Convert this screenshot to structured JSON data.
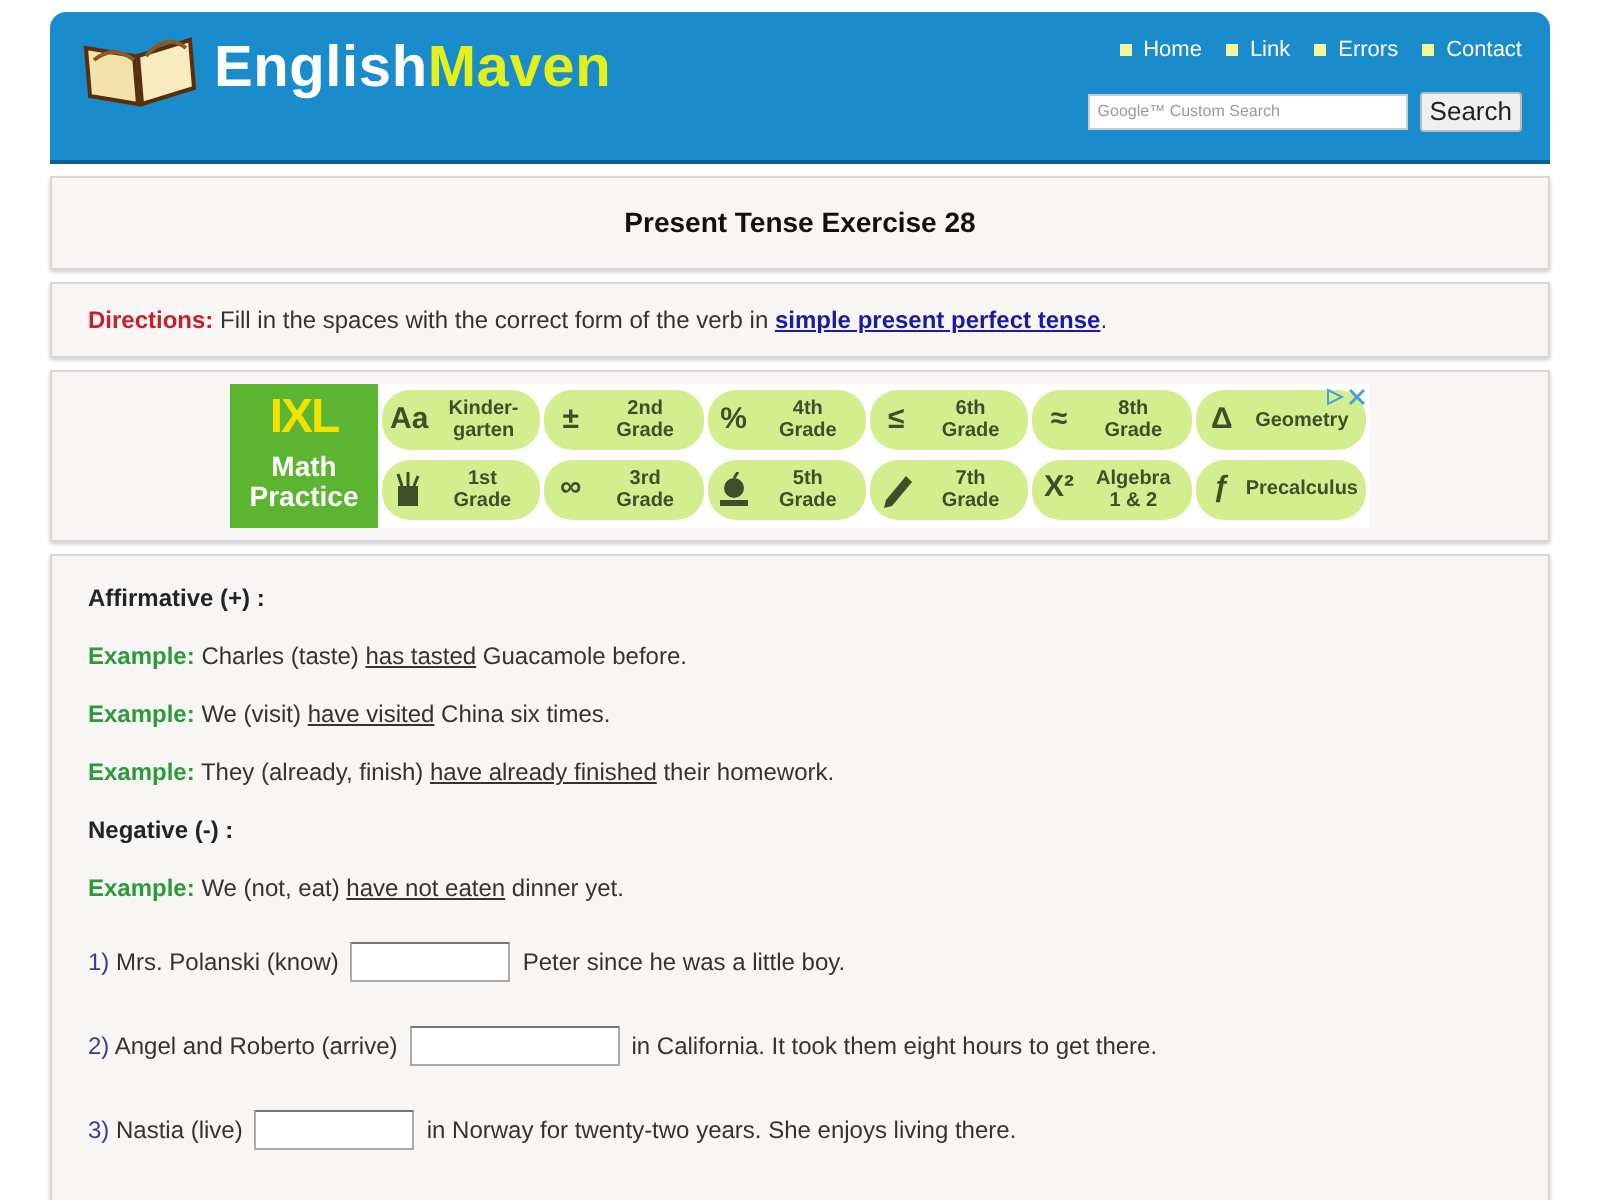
{
  "header": {
    "logo": {
      "first": "English",
      "second": "Maven"
    },
    "nav": [
      "Home",
      "Link",
      "Errors",
      "Contact"
    ],
    "search": {
      "placeholder": "Google™ Custom Search",
      "button": "Search"
    }
  },
  "title": "Present Tense Exercise 28",
  "directions": {
    "label": "Directions:",
    "text": "Fill in the spaces with the correct form of the verb in",
    "link": "simple present perfect tense",
    "end": "."
  },
  "ad": {
    "brand": "IXL",
    "tagline": [
      "Math",
      "Practice"
    ],
    "tiles": [
      {
        "kind": "symbol",
        "symbol": "Aa",
        "lines": [
          "Kinder-",
          "garten"
        ]
      },
      {
        "kind": "symbol",
        "symbol": "±",
        "lines": [
          "2nd",
          "Grade"
        ]
      },
      {
        "kind": "symbol",
        "symbol": "%",
        "lines": [
          "4th",
          "Grade"
        ]
      },
      {
        "kind": "symbol",
        "symbol": "≤",
        "lines": [
          "6th",
          "Grade"
        ]
      },
      {
        "kind": "symbol",
        "symbol": "≈",
        "lines": [
          "8th",
          "Grade"
        ]
      },
      {
        "kind": "symbol",
        "symbol": "Δ",
        "lines": [
          "Geometry"
        ]
      },
      {
        "kind": "cup",
        "lines": [
          "1st",
          "Grade"
        ]
      },
      {
        "kind": "symbol",
        "symbol": "∞",
        "lines": [
          "3rd",
          "Grade"
        ]
      },
      {
        "kind": "apple",
        "lines": [
          "5th",
          "Grade"
        ]
      },
      {
        "kind": "pencil",
        "lines": [
          "7th",
          "Grade"
        ]
      },
      {
        "kind": "symbol",
        "symbol": "X²",
        "lines": [
          "Algebra",
          "1 & 2"
        ]
      },
      {
        "kind": "symbol",
        "symbol": "ƒ",
        "lines": [
          "Precalculus"
        ]
      }
    ]
  },
  "content": [
    {
      "kind": "heading",
      "text": "Affirmative (+) :"
    },
    {
      "kind": "example",
      "label": "Example:",
      "before": "Charles (taste)",
      "answer": "has tasted",
      "after": "Guacamole before."
    },
    {
      "kind": "example",
      "label": "Example:",
      "before": "We (visit)",
      "answer": "have visited",
      "after": "China six times."
    },
    {
      "kind": "example",
      "label": "Example:",
      "before": "They (already, finish)",
      "answer": "have already finished",
      "after": "their homework."
    },
    {
      "kind": "heading",
      "text": "Negative (-) :"
    },
    {
      "kind": "example",
      "label": "Example:",
      "before": "We (not, eat)",
      "answer": "have not eaten",
      "after": "dinner yet."
    }
  ],
  "questions": [
    {
      "number": "1)",
      "before": "Mrs. Polanski (know)",
      "after": "Peter since he was a little boy."
    },
    {
      "number": "2)",
      "before": "Angel and Roberto (arrive)",
      "after": "in California. It took them eight hours to get there."
    },
    {
      "number": "3)",
      "before": "Nastia (live)",
      "after": "in Norway for twenty-two years. She enjoys living there."
    }
  ]
}
